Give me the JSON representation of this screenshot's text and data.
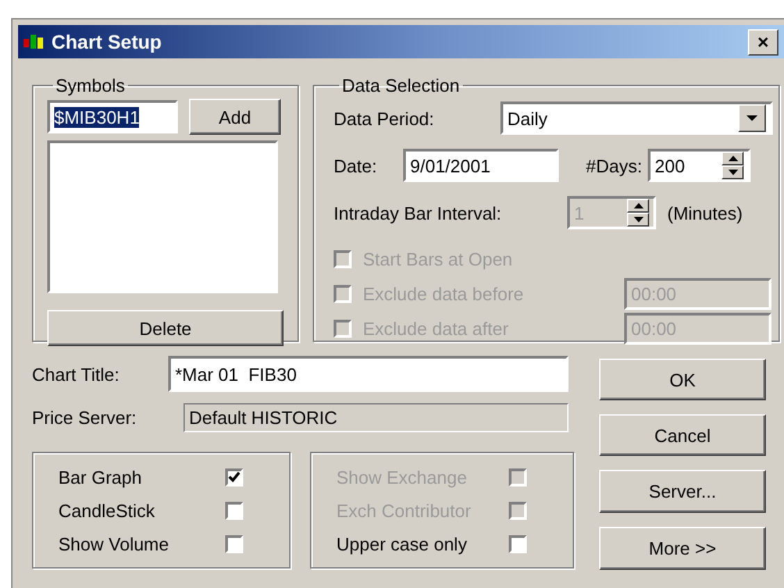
{
  "window": {
    "title": "Chart Setup",
    "close": "×"
  },
  "symbols": {
    "label": "Symbols",
    "input": {
      "value": "$MIB30H1",
      "selected": true
    },
    "add_button": "Add",
    "delete_button": "Delete"
  },
  "data_selection": {
    "label": "Data Selection",
    "data_period": {
      "label": "Data Period:",
      "value": "Daily"
    },
    "date": {
      "label": "Date:",
      "value": "9/01/2001"
    },
    "days": {
      "label": "#Days:",
      "value": "200"
    },
    "interval": {
      "label": "Intraday Bar Interval:",
      "value": "1",
      "disabled": true,
      "unit": "(Minutes)"
    },
    "options": [
      {
        "label": "Start Bars at Open",
        "checked": false,
        "disabled": true
      },
      {
        "label": "Exclude data before",
        "checked": false,
        "disabled": true,
        "time": "00:00"
      },
      {
        "label": "Exclude data after",
        "checked": false,
        "disabled": true,
        "time": "00:00"
      }
    ]
  },
  "chart_title": {
    "label": "Chart Title:",
    "value": "*Mar 01  FIB30"
  },
  "price_server": {
    "label": "Price Server:",
    "value": "Default HISTORIC"
  },
  "graph_options": [
    {
      "label": "Bar Graph",
      "checked": true,
      "disabled": false
    },
    {
      "label": "CandleStick",
      "checked": false,
      "disabled": false
    },
    {
      "label": "Show Volume",
      "checked": false,
      "disabled": false
    }
  ],
  "display_options": [
    {
      "label": "Show Exchange",
      "checked": false,
      "disabled": true
    },
    {
      "label": "Exch Contributor",
      "checked": false,
      "disabled": true
    },
    {
      "label": "Upper case only",
      "checked": false,
      "disabled": false
    }
  ],
  "buttons": [
    "OK",
    "Cancel",
    "Server...",
    "More >>"
  ]
}
